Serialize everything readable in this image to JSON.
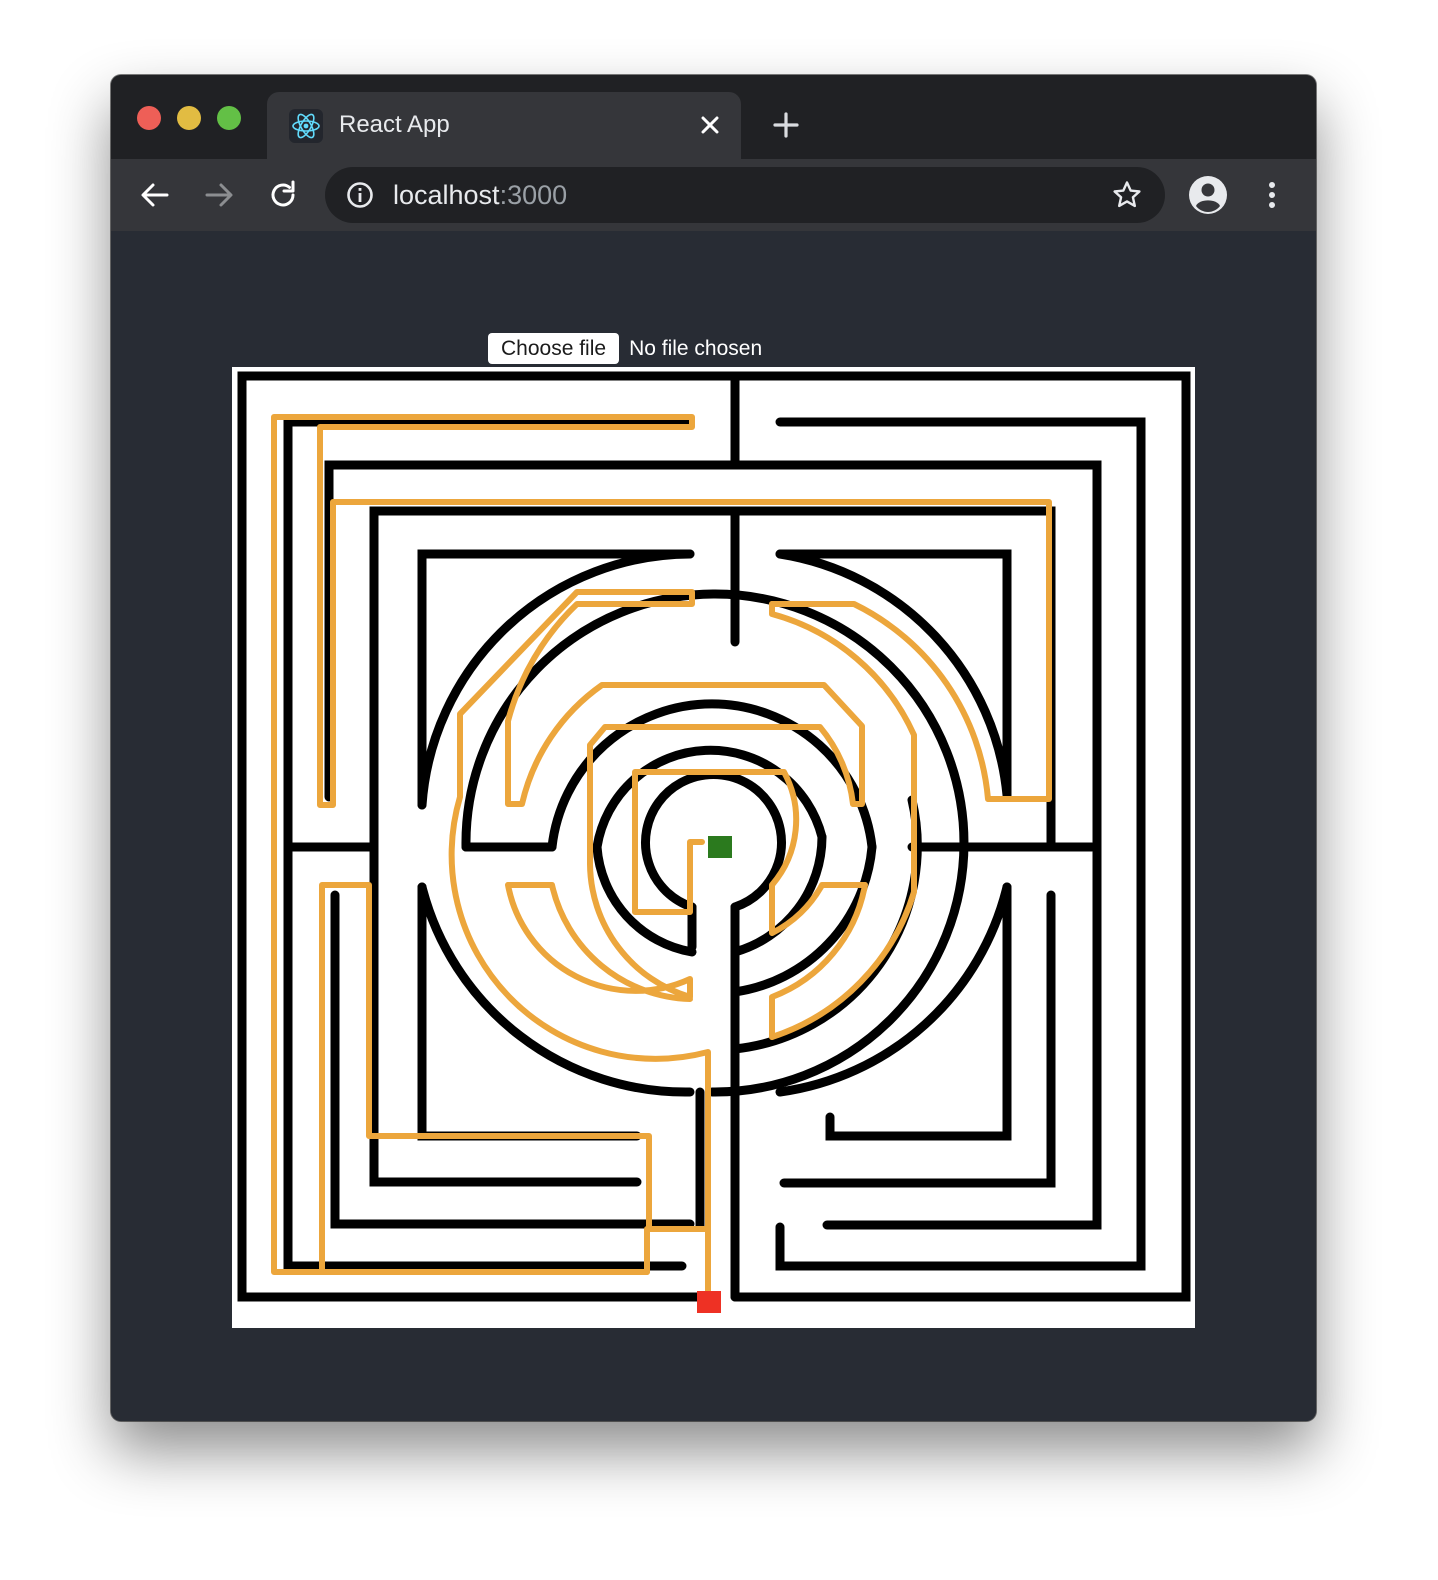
{
  "window": {
    "controls": [
      "close",
      "minimize",
      "maximize"
    ]
  },
  "tab": {
    "title": "React App",
    "favicon": "react-logo-icon"
  },
  "toolbar": {
    "back_icon": "arrow-left-icon",
    "forward_icon": "arrow-right-icon",
    "reload_icon": "reload-icon",
    "url_host": "localhost",
    "url_port": ":3000",
    "info_icon": "info-icon",
    "bookmark_icon": "star-icon",
    "profile_icon": "account-circle-icon",
    "menu_icon": "more-vert-icon"
  },
  "file_input": {
    "button_label": "Choose file",
    "status": "No file chosen"
  },
  "maze": {
    "wall_color": "#000000",
    "path_color": "#eca63c",
    "start_color": "#ee3124",
    "goal_color": "#2b7a1e"
  }
}
